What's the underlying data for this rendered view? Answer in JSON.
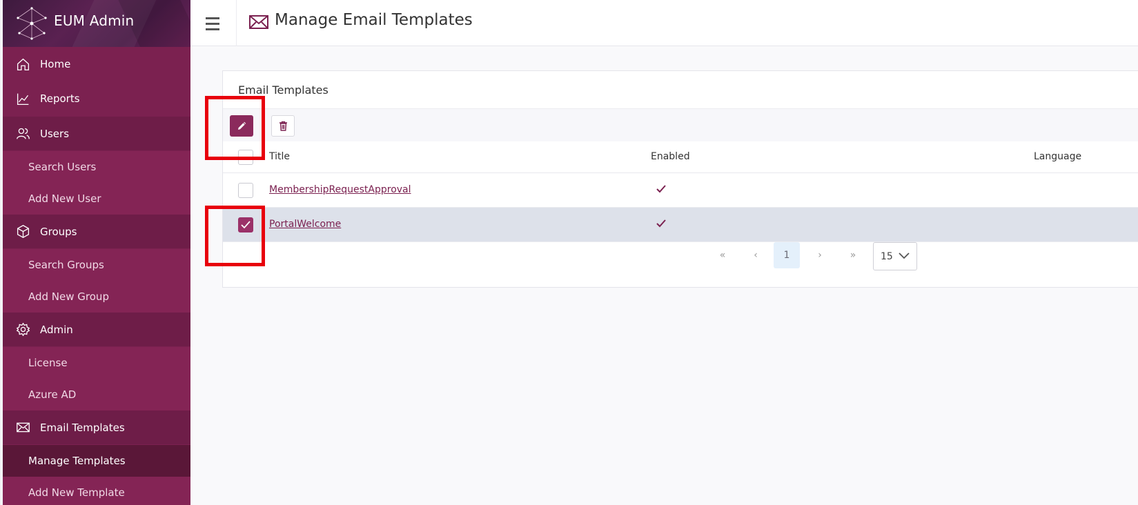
{
  "app": {
    "name": "EUM Admin"
  },
  "header": {
    "page_title": "Manage Email Templates"
  },
  "sidebar": {
    "items": [
      {
        "label": "Home",
        "icon": "home-icon",
        "kind": "section"
      },
      {
        "label": "Reports",
        "icon": "chart-icon",
        "kind": "section"
      },
      {
        "label": "Users",
        "icon": "users-icon",
        "kind": "section"
      },
      {
        "label": "Search Users",
        "kind": "sub"
      },
      {
        "label": "Add New User",
        "kind": "sub"
      },
      {
        "label": "Groups",
        "icon": "cube-icon",
        "kind": "section"
      },
      {
        "label": "Search Groups",
        "kind": "sub"
      },
      {
        "label": "Add New Group",
        "kind": "sub"
      },
      {
        "label": "Admin",
        "icon": "gear-icon",
        "kind": "section"
      },
      {
        "label": "License",
        "kind": "sub"
      },
      {
        "label": "Azure AD",
        "kind": "sub"
      },
      {
        "label": "Email Templates",
        "icon": "mail-icon",
        "kind": "section"
      },
      {
        "label": "Manage Templates",
        "kind": "sub",
        "active": true
      },
      {
        "label": "Add New Template",
        "kind": "sub"
      }
    ]
  },
  "card": {
    "title": "Email Templates",
    "toolbar": {
      "edit_icon": "pencil-icon",
      "delete_icon": "trash-icon"
    },
    "columns": {
      "title": "Title",
      "enabled": "Enabled",
      "language": "Language"
    },
    "rows": [
      {
        "title": "MembershipRequestApproval",
        "enabled": true,
        "selected": false
      },
      {
        "title": "PortalWelcome",
        "enabled": true,
        "selected": true
      }
    ],
    "pager": {
      "first": "«",
      "prev": "‹",
      "current": "1",
      "next": "›",
      "last": "»",
      "page_size": "15"
    }
  },
  "colors": {
    "brand": "#7b2150",
    "accent": "#9b3168",
    "highlight": "#e8000b",
    "selected_row": "#dde1ea"
  }
}
